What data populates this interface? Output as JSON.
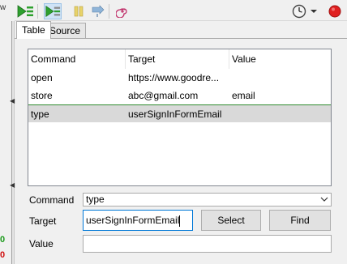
{
  "left_strip": {
    "cut_label": "w",
    "pass_count": "0",
    "fail_count": "0"
  },
  "icons": {
    "play_all": "play-all-icon",
    "play_current": "play-current-icon",
    "pause": "pause-icon",
    "step": "step-icon",
    "rollup": "rollup-icon",
    "speed_clock": "clock-icon",
    "dropdown": "chevron-down-icon",
    "record": "record-icon"
  },
  "tabs": [
    {
      "label": "Table"
    },
    {
      "label": "Source"
    }
  ],
  "table": {
    "headers": [
      "Command",
      "Target",
      "Value"
    ],
    "rows": [
      {
        "command": "open",
        "target": "https://www.goodre...",
        "value": ""
      },
      {
        "command": "store",
        "target": "abc@gmail.com",
        "value": "email"
      },
      {
        "command": "type",
        "target": "userSignInFormEmail",
        "value": ""
      }
    ],
    "selected_row": 2
  },
  "form": {
    "command_label": "Command",
    "command_value": "type",
    "target_label": "Target",
    "target_value": "userSignInFormEmail",
    "value_label": "Value",
    "value_value": "",
    "select_button": "Select",
    "find_button": "Find"
  },
  "colors": {
    "pass": "#1a9a1a",
    "fail": "#d01010",
    "record": "#e02020",
    "selection": "#d9d9d9"
  }
}
